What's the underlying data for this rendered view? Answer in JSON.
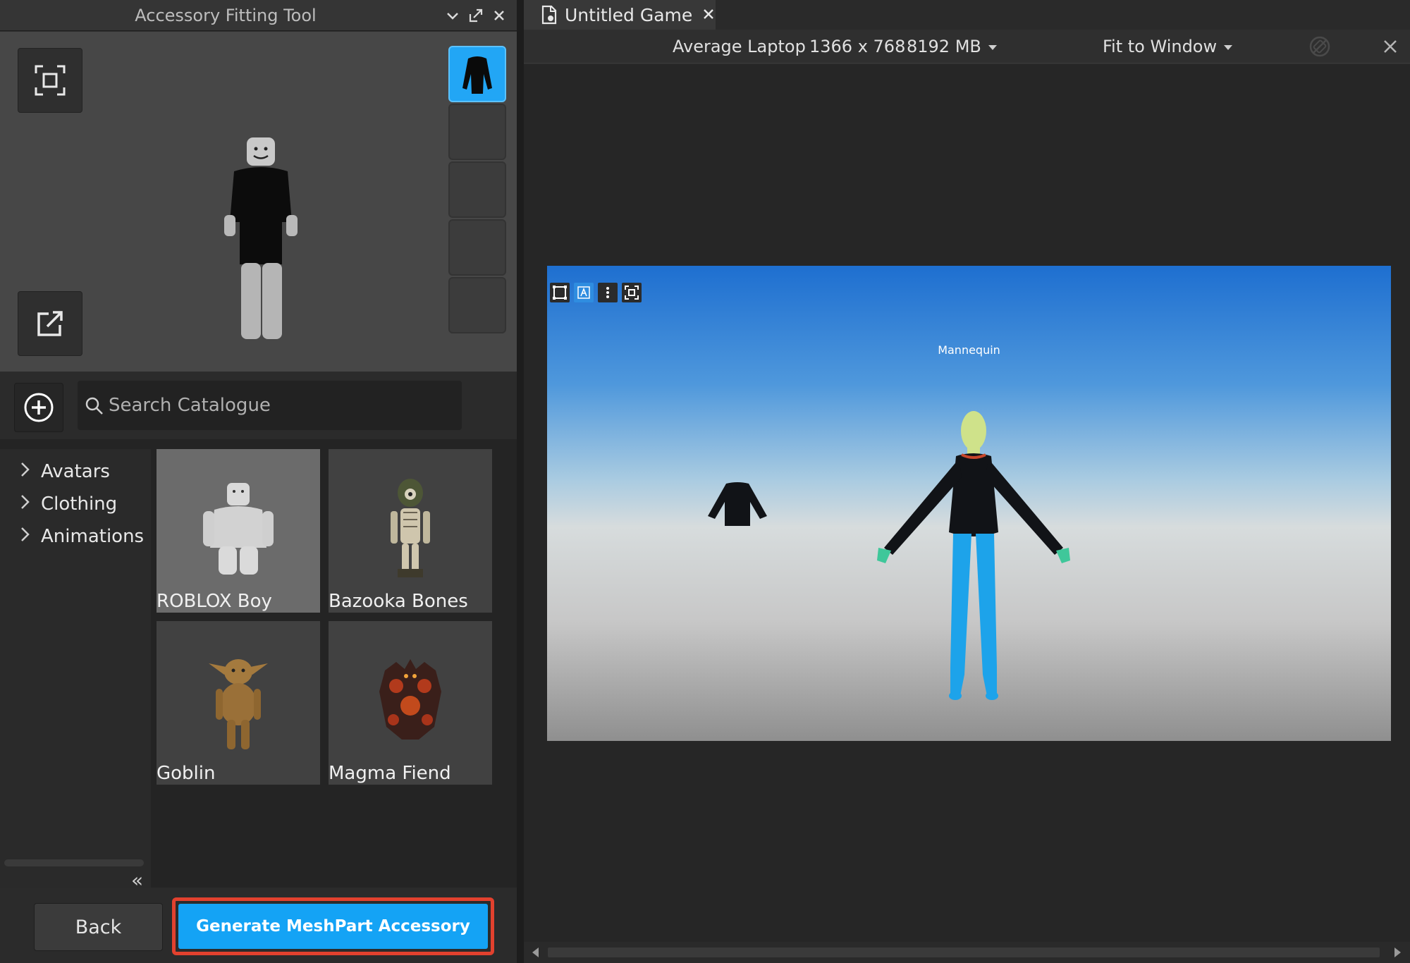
{
  "left_panel": {
    "title": "Accessory Fitting Tool",
    "search": {
      "placeholder": "Search Catalogue"
    },
    "tree": [
      {
        "label": "Avatars"
      },
      {
        "label": "Clothing"
      },
      {
        "label": "Animations"
      }
    ],
    "catalog": [
      {
        "name": "ROBLOX Boy",
        "selected": true
      },
      {
        "name": "Bazooka Bones",
        "selected": false
      },
      {
        "name": "Goblin",
        "selected": false
      },
      {
        "name": "Magma Fiend",
        "selected": false
      }
    ],
    "footer": {
      "back_label": "Back",
      "generate_label": "Generate MeshPart Accessory"
    }
  },
  "right_panel": {
    "tab_title": "Untitled Game",
    "device": {
      "name": "Average Laptop",
      "resolution": "1366 x 768",
      "memory": "8192 MB",
      "fit": "Fit to Window"
    },
    "scene_label": "Mannequin"
  },
  "colors": {
    "accent": "#14a3f5",
    "highlight_outline": "#e2412e"
  }
}
